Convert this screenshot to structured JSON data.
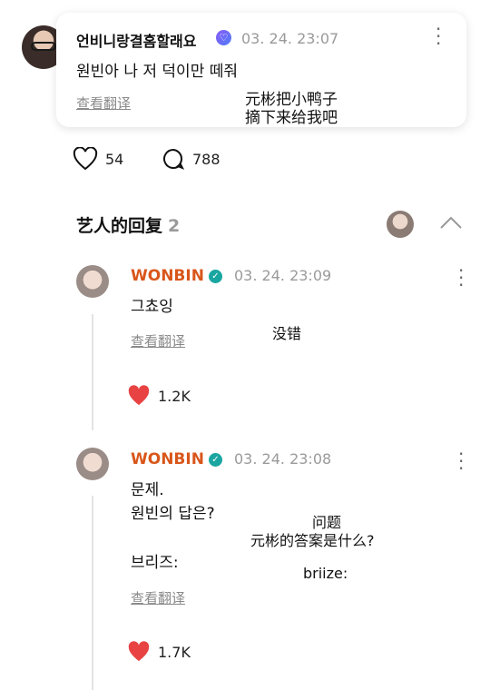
{
  "top_comment": {
    "username": "언비니랑결홈할래요",
    "timestamp": "03. 24. 23:07",
    "text": "원빈아 나 저 덕이만 떼줘",
    "translate_label": "查看翻译",
    "overlay_line1": "元彬把小鸭子",
    "overlay_line2": "摘下来给我吧"
  },
  "stats": {
    "likes": "54",
    "comments": "788"
  },
  "artist_replies": {
    "title": "艺人的回复",
    "count": "2"
  },
  "replies": [
    {
      "username": "WONBIN",
      "timestamp": "03. 24. 23:09",
      "text": "그쵸잉",
      "translate_label": "查看翻译",
      "overlay": "没错",
      "likes": "1.2K"
    },
    {
      "username": "WONBIN",
      "timestamp": "03. 24. 23:08",
      "text_line1": "문제.",
      "text_line2": "원빈의 답은?",
      "text_line3": "브리즈:",
      "translate_label": "查看翻译",
      "overlay_line1": "问题",
      "overlay_line2": "元彬的答案是什么?",
      "overlay_line3": "briize:",
      "likes": "1.7K"
    }
  ],
  "colors": {
    "artist_name": "#d9561b",
    "heart": "#e84242",
    "verified_reply": "#1aa6a0"
  }
}
